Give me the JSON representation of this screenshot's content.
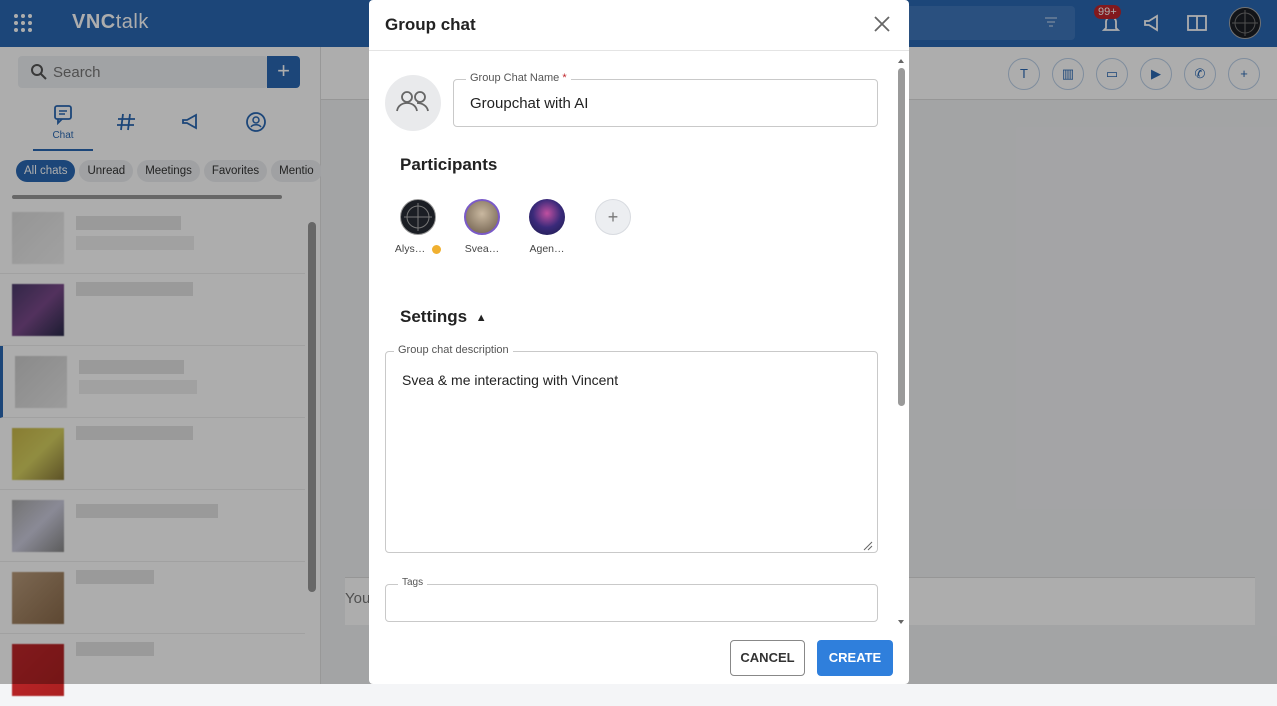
{
  "app": {
    "logo_bold": "VNC",
    "logo_rest": "talk",
    "notification_badge": "99+"
  },
  "sidebar": {
    "search_placeholder": "Search",
    "add_label": "+",
    "tabs": [
      {
        "label": "Chat",
        "icon": "chat-icon"
      },
      {
        "label": "",
        "icon": "channels-hash-icon"
      },
      {
        "label": "",
        "icon": "broadcast-megaphone-icon"
      },
      {
        "label": "",
        "icon": "contacts-icon"
      }
    ],
    "filters": [
      "All chats",
      "Unread",
      "Meetings",
      "Favorites",
      "Mentio"
    ]
  },
  "main": {
    "composer_placeholder": "You"
  },
  "dialog": {
    "title": "Group chat",
    "name_label": "Group Chat Name",
    "name_required": "*",
    "name_value": "Groupchat with AI",
    "participants_title": "Participants",
    "participants": [
      {
        "name": "Alys…",
        "avatar_color": "#1b1e24",
        "owner_badge": true
      },
      {
        "name": "Svea…",
        "avatar_color": "#8a7a66",
        "owner_badge": false
      },
      {
        "name": "Agen…",
        "avatar_color": "#4a2e7a",
        "owner_badge": false
      }
    ],
    "add_participant": "+",
    "settings_title": "Settings",
    "settings_caret": "▲",
    "description_label": "Group chat description",
    "description_value": "Svea & me interacting with Vincent",
    "tags_label": "Tags",
    "cancel_label": "CANCEL",
    "create_label": "CREATE"
  },
  "colors": {
    "brand": "#2a68b3",
    "create_button": "#2f7fdc",
    "badge": "#c0262b"
  }
}
